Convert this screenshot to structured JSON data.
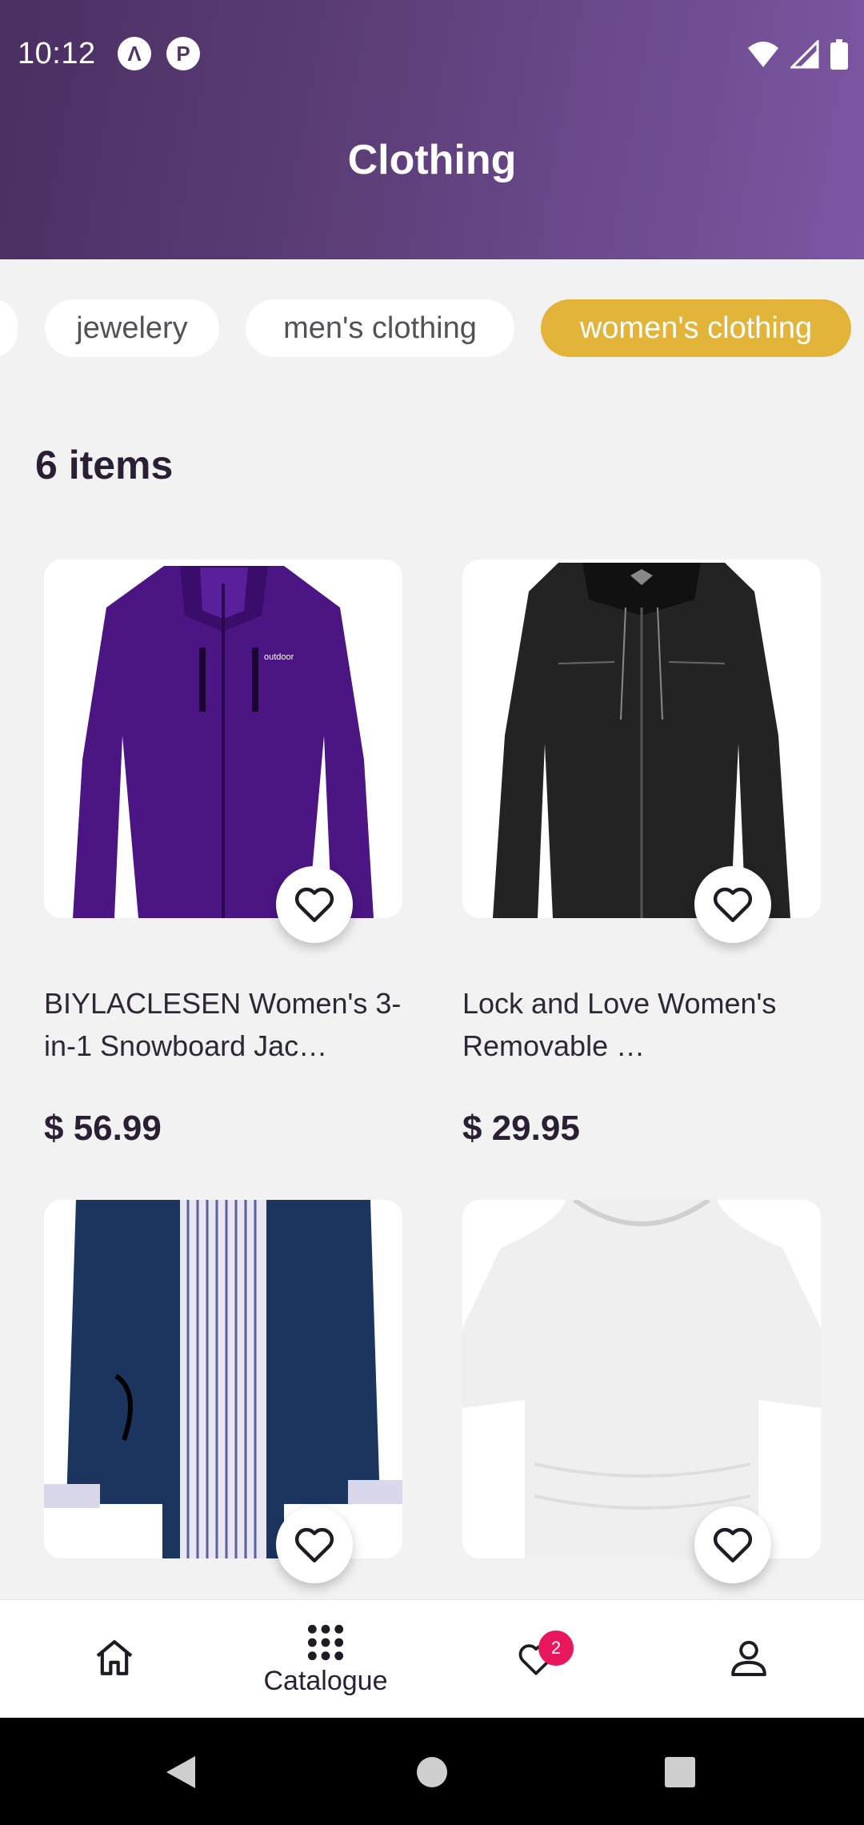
{
  "status_bar": {
    "time": "10:12"
  },
  "header": {
    "title": "Clothing"
  },
  "categories": [
    {
      "label": ""
    },
    {
      "label": "jewelery"
    },
    {
      "label": "men's clothing"
    },
    {
      "label": "women's clothing",
      "selected": true
    }
  ],
  "results": {
    "count_label": "6 items"
  },
  "products": [
    {
      "name": "BIYLACLESEN Women's 3-in-1 Snowboard Jac…",
      "price": "$ 56.99"
    },
    {
      "name": "Lock and Love Women's Removable …",
      "price": "$ 29.95"
    },
    {
      "name": "",
      "price": ""
    },
    {
      "name": "",
      "price": ""
    }
  ],
  "bottom_nav": {
    "home_label": "",
    "catalogue_label": "Catalogue",
    "favorites_badge": "2",
    "profile_label": ""
  },
  "colors": {
    "header_gradient_start": "#4a2f62",
    "header_gradient_end": "#7d57a3",
    "accent_chip": "#e2b43a",
    "badge": "#e8175d",
    "background": "#f2f2f3"
  }
}
